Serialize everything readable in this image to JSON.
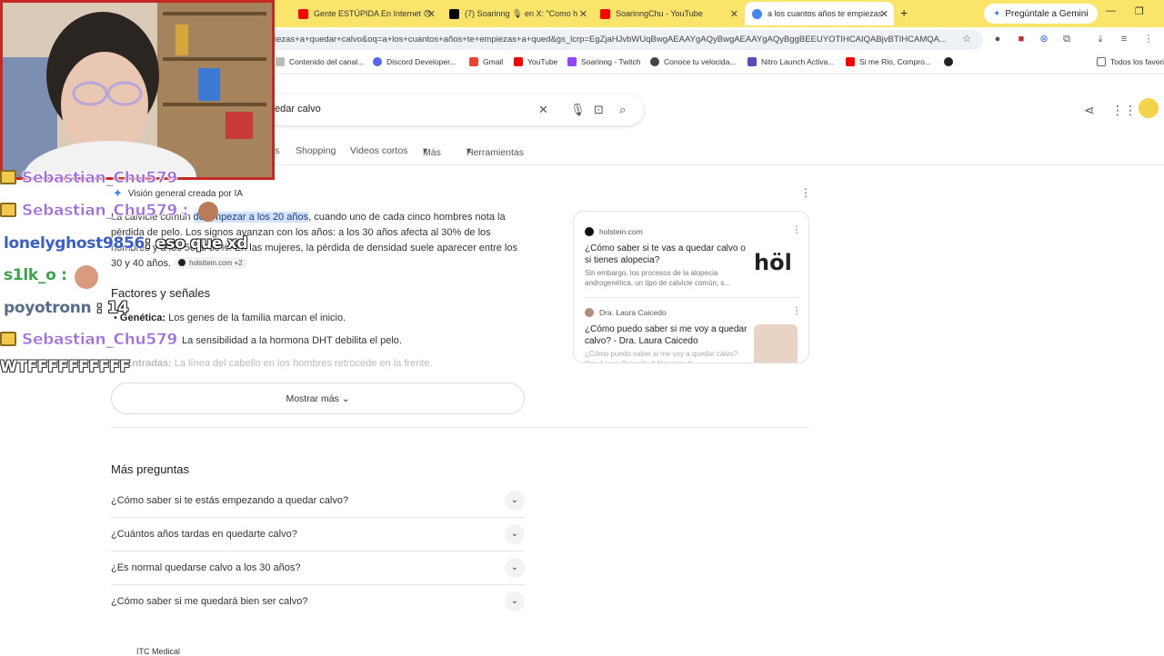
{
  "tabs": [
    {
      "title": "Gente ESTÚPIDA En Internet 😠",
      "fav": "#ff0000"
    },
    {
      "title": "(7) Soarinng 🎙 en X: \"Como h",
      "fav": "#000000"
    },
    {
      "title": "SoarinngChu - YouTube",
      "fav": "#ff0000"
    },
    {
      "title": "a los cuantos años te empiezas",
      "fav": "#4285f4"
    }
  ],
  "gemini_label": "Pregúntale a Gemini",
  "address": "iezas+a+quedar+calvo&oq=a+los+cuantos+años+te+empiezas+a+qued&gs_lcrp=EgZjaHJvbWUqBwgAEAAYgAQyBwgAEAAYgAQyBggBEEUYOTIHCAIQABjvBTIHCAMQA...",
  "bookmarks": [
    "Contenido del canal...",
    "Discord Developer...",
    "Gmail",
    "YouTube",
    "Soarinng - Twitch",
    "Conoce tu velocida...",
    "Nitro Launch Activa...",
    "Si me Rio, Compro...",
    "Todos los favori"
  ],
  "search": {
    "query": "edar calvo"
  },
  "filters": [
    "s",
    "Shopping",
    "Videos cortos",
    "Más",
    "Herramientas"
  ],
  "ai": {
    "header": "Visión general creada por IA",
    "p_start": "La calvicie común ",
    "p_highlight": "de empezar a los 20 años",
    "p_rest": ", cuando uno de cada cinco hombres nota la pérdida de pelo. Los signos avanzan con los años: a los 30 años afecta al 30% de los hombres y a los 50 al 50%. En las mujeres, la pérdida de densidad suele aparecer entre los 30 y 40 años.",
    "cite": "holsttein.com +2",
    "section_title": "Factores y señales",
    "bullet1_label": "Genética:",
    "bullet1_text": " Los genes de la familia marcan el inicio.",
    "bullet2_text": "La sensibilidad a la hormona DHT debilita el pelo.",
    "bullet3_label": "Entradas:",
    "bullet3_text": " La línea del cabello en los hombres retrocede en la frente.",
    "show_more": "Mostrar más"
  },
  "sources": [
    {
      "site": "holstein.com",
      "title": "¿Cómo saber si te vas a quedar calvo o si tienes alopecia?",
      "snippet": "Sin embargo, los procesos de la alopecia androgenética, un tipo de calvicie común, s...",
      "logo": "höl"
    },
    {
      "site": "Dra. Laura Caicedo",
      "title": "¿Cómo puedo saber si me voy a quedar calvo? - Dra. Laura Caicedo",
      "snippet": "¿Cómo puedo saber si me voy a quedar calvo? Dra. Laura Caicedo. * Alopecia. *"
    }
  ],
  "paa": {
    "title": "Más preguntas",
    "questions": [
      "¿Cómo saber si te estás empezando a quedar calvo?",
      "¿Cuántos años tardas en quedarte calvo?",
      "¿Es normal quedarse calvo a los 30 años?",
      "¿Cómo saber si me quedará bien ser calvo?"
    ]
  },
  "bottom_result": "ITC Medical",
  "chat": [
    {
      "user": "Sebastian_Chu579",
      "msg": ""
    },
    {
      "user": "Sebastian_Chu579 :",
      "msg": ""
    },
    {
      "user": "lonelyghost9856",
      "msg": ": eso que xd"
    },
    {
      "user": "s1lk_o :",
      "msg": ""
    },
    {
      "user": "poyotronn",
      "msg": " : 14"
    },
    {
      "user": "Sebastian_Chu579",
      "msg": ""
    },
    {
      "user": "WTFFFFFFFFFF",
      "msg": ""
    }
  ],
  "colors": {
    "tabbar": "#fbe46a",
    "webcam_border": "#c62828",
    "highlight": "#d4e3fb"
  }
}
